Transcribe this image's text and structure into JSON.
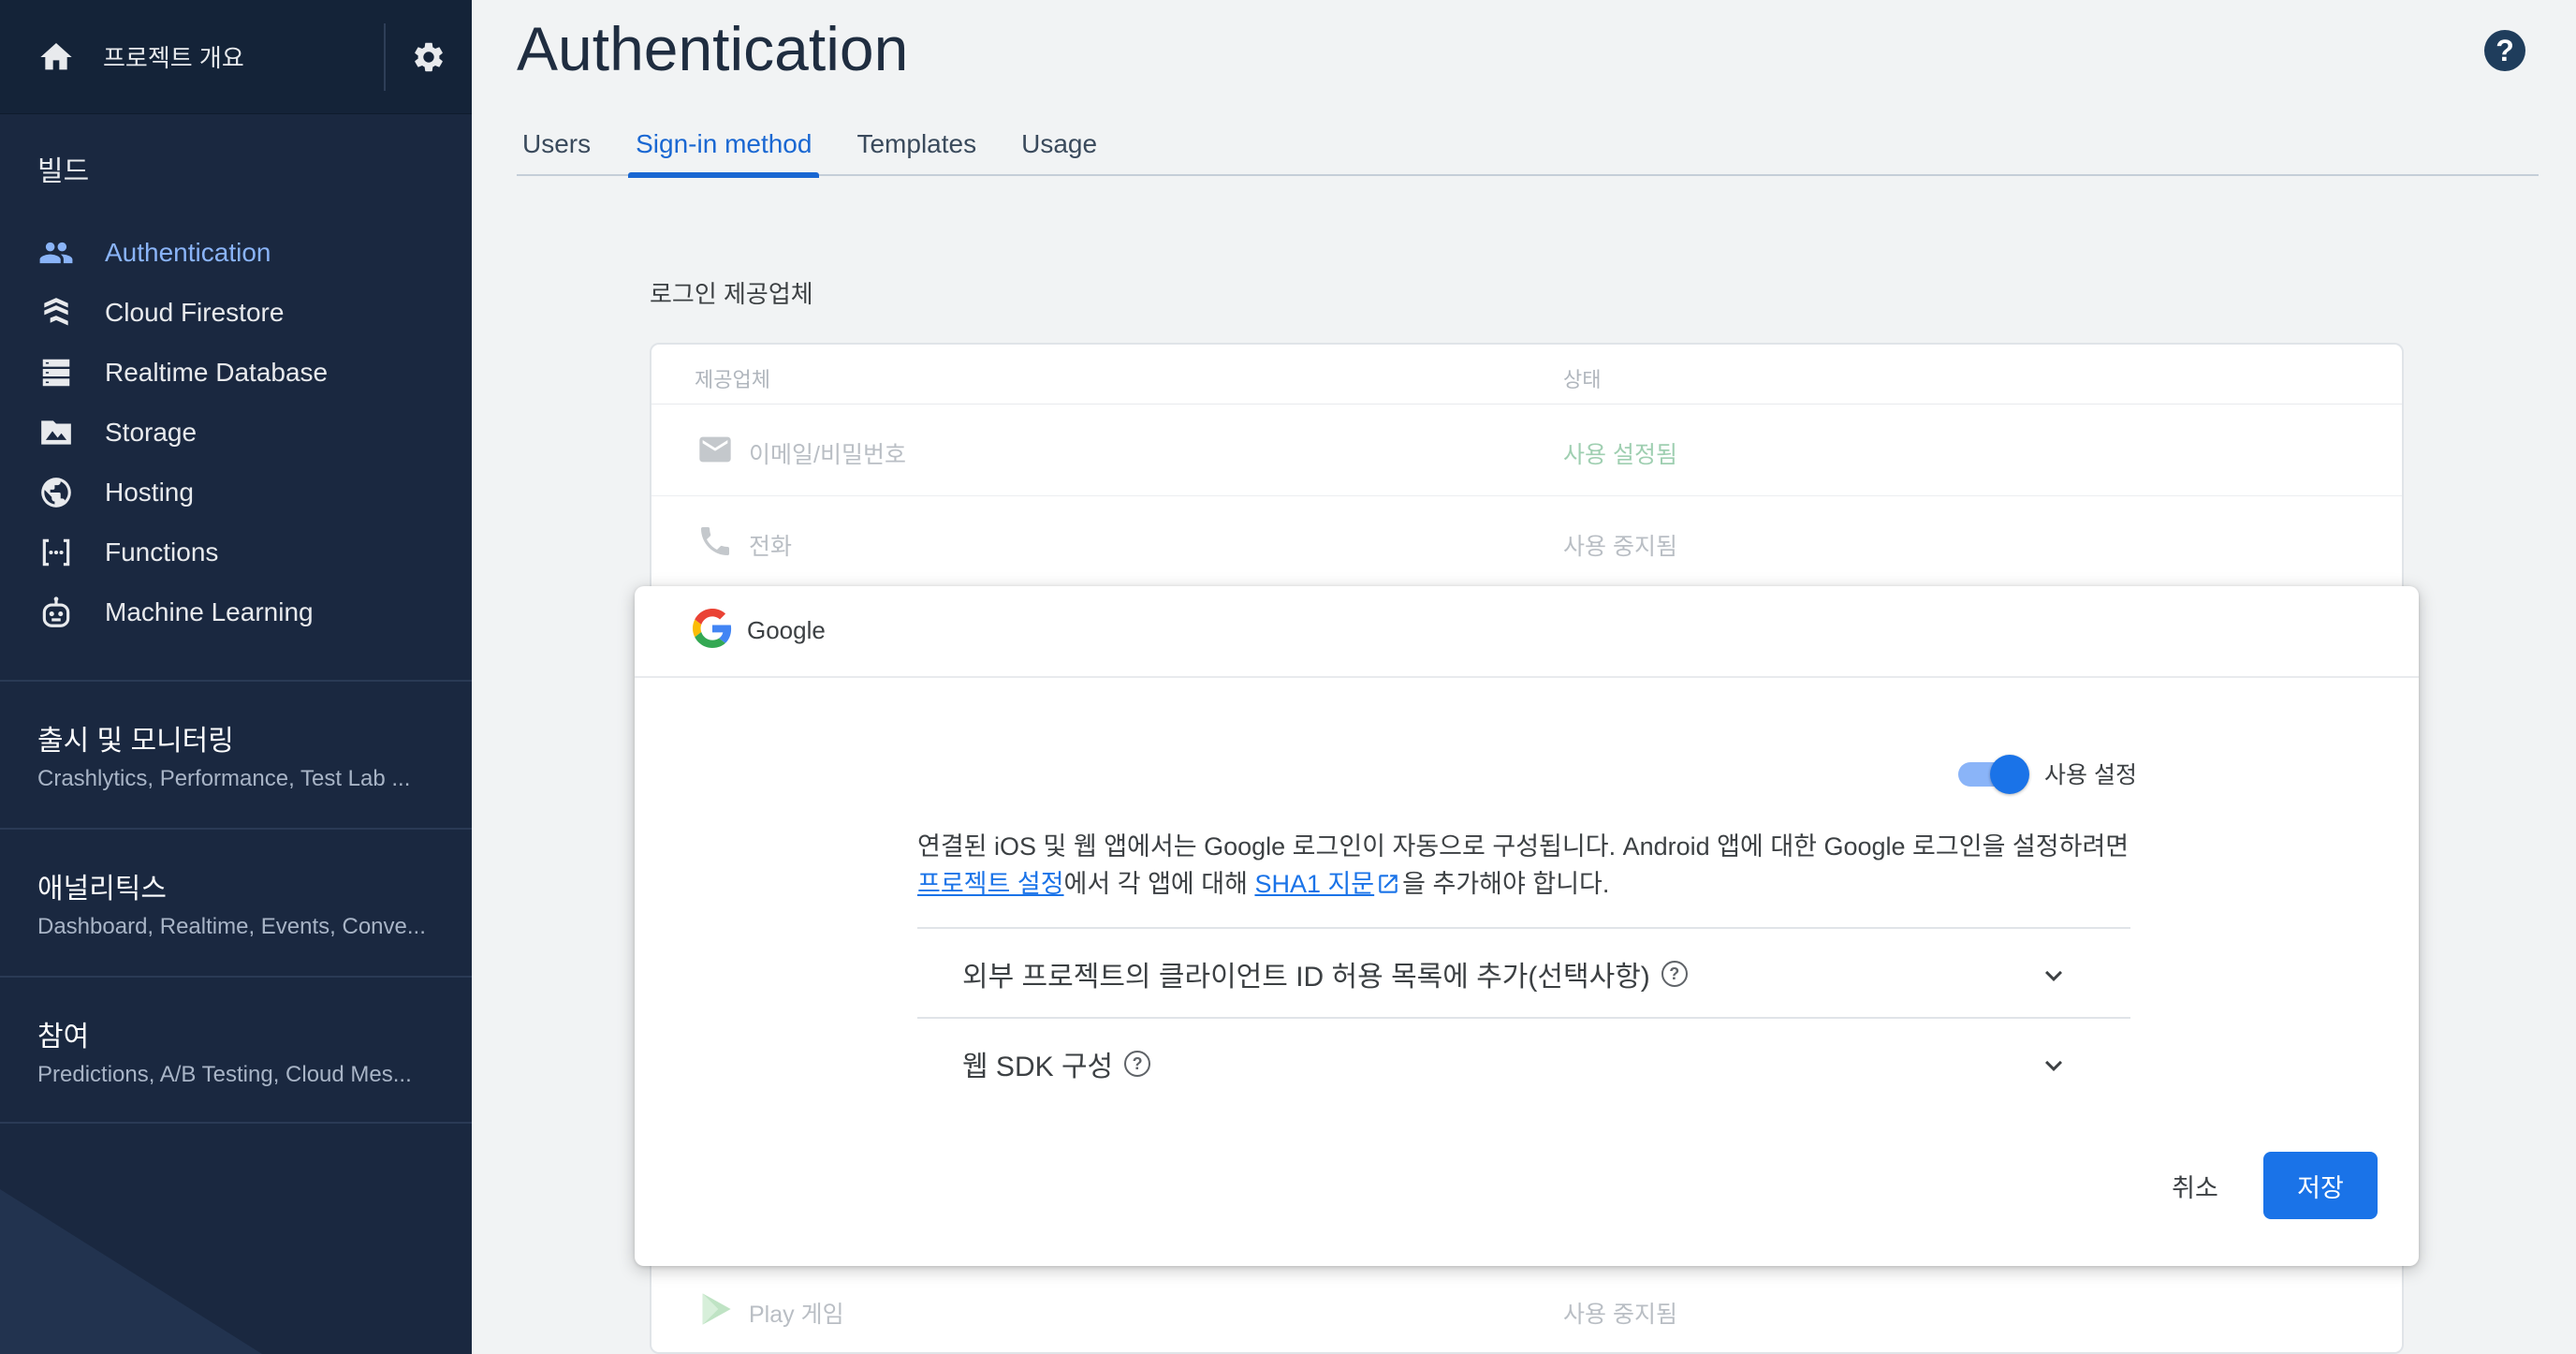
{
  "sidebar": {
    "project_title": "프로젝트 개요",
    "build_title": "빌드",
    "items": [
      {
        "label": "Authentication",
        "icon": "people-icon"
      },
      {
        "label": "Cloud Firestore",
        "icon": "firestore-icon"
      },
      {
        "label": "Realtime Database",
        "icon": "database-icon"
      },
      {
        "label": "Storage",
        "icon": "image-icon"
      },
      {
        "label": "Hosting",
        "icon": "globe-icon"
      },
      {
        "label": "Functions",
        "icon": "functions-icon"
      },
      {
        "label": "Machine Learning",
        "icon": "robot-icon"
      }
    ],
    "groups": [
      {
        "title": "출시 및 모니터링",
        "subtitle": "Crashlytics, Performance, Test Lab ..."
      },
      {
        "title": "애널리틱스",
        "subtitle": "Dashboard, Realtime, Events, Conve..."
      },
      {
        "title": "참여",
        "subtitle": "Predictions, A/B Testing, Cloud Mes..."
      }
    ]
  },
  "header": {
    "title": "Authentication",
    "help": "?",
    "tabs": [
      {
        "label": "Users"
      },
      {
        "label": "Sign-in method"
      },
      {
        "label": "Templates"
      },
      {
        "label": "Usage"
      }
    ]
  },
  "providers": {
    "section_label": "로그인 제공업체",
    "col_provider": "제공업체",
    "col_status": "상태",
    "rows": [
      {
        "name": "이메일/비밀번호",
        "status": "사용 설정됨"
      },
      {
        "name": "전화",
        "status": "사용 중지됨"
      },
      {
        "name": "Play 게임",
        "status": "사용 중지됨"
      }
    ]
  },
  "dialog": {
    "provider_name": "Google",
    "toggle_label": "사용 설정",
    "toggle_on": true,
    "desc_part1": "연결된 iOS 및 웹 앱에서는 Google 로그인이 자동으로 구성됩니다. Android 앱에 대한 Google 로그인을 설정하려면 ",
    "link_project_settings": "프로젝트 설정",
    "desc_part2": "에서 각 앱에 대해 ",
    "link_sha1": "SHA1 지문",
    "desc_part3": "을 추가해야 합니다.",
    "accordion1": "외부 프로젝트의 클라이언트 ID 허용 목록에 추가(선택사항)",
    "accordion2": "웹 SDK 구성",
    "cancel": "취소",
    "save": "저장"
  },
  "colors": {
    "sidebar_bg": "#1a2840",
    "accent": "#1a73e8",
    "active_nav": "#8ab4f8",
    "enabled_status": "#9fcfb1"
  }
}
